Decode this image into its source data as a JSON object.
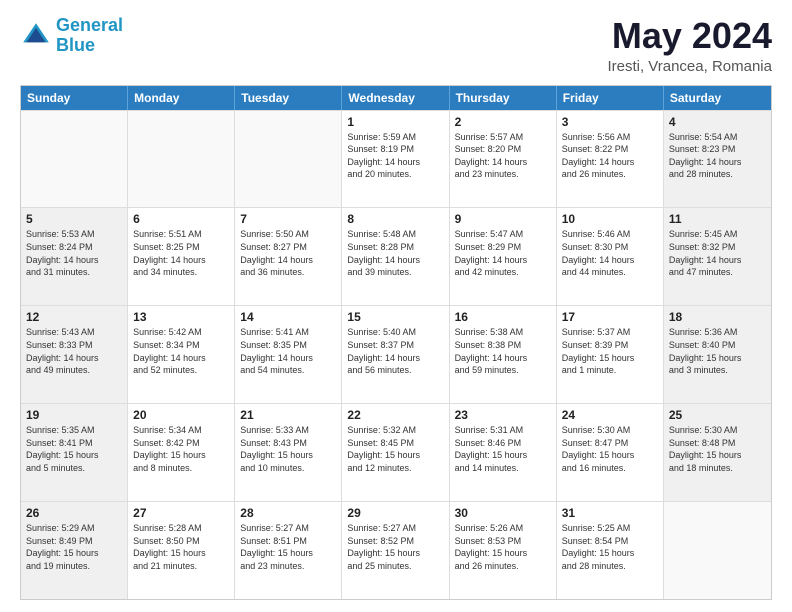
{
  "logo": {
    "text1": "General",
    "text2": "Blue"
  },
  "title": "May 2024",
  "location": "Iresti, Vrancea, Romania",
  "days": [
    "Sunday",
    "Monday",
    "Tuesday",
    "Wednesday",
    "Thursday",
    "Friday",
    "Saturday"
  ],
  "rows": [
    [
      {
        "day": "",
        "info": ""
      },
      {
        "day": "",
        "info": ""
      },
      {
        "day": "",
        "info": ""
      },
      {
        "day": "1",
        "info": "Sunrise: 5:59 AM\nSunset: 8:19 PM\nDaylight: 14 hours\nand 20 minutes."
      },
      {
        "day": "2",
        "info": "Sunrise: 5:57 AM\nSunset: 8:20 PM\nDaylight: 14 hours\nand 23 minutes."
      },
      {
        "day": "3",
        "info": "Sunrise: 5:56 AM\nSunset: 8:22 PM\nDaylight: 14 hours\nand 26 minutes."
      },
      {
        "day": "4",
        "info": "Sunrise: 5:54 AM\nSunset: 8:23 PM\nDaylight: 14 hours\nand 28 minutes."
      }
    ],
    [
      {
        "day": "5",
        "info": "Sunrise: 5:53 AM\nSunset: 8:24 PM\nDaylight: 14 hours\nand 31 minutes."
      },
      {
        "day": "6",
        "info": "Sunrise: 5:51 AM\nSunset: 8:25 PM\nDaylight: 14 hours\nand 34 minutes."
      },
      {
        "day": "7",
        "info": "Sunrise: 5:50 AM\nSunset: 8:27 PM\nDaylight: 14 hours\nand 36 minutes."
      },
      {
        "day": "8",
        "info": "Sunrise: 5:48 AM\nSunset: 8:28 PM\nDaylight: 14 hours\nand 39 minutes."
      },
      {
        "day": "9",
        "info": "Sunrise: 5:47 AM\nSunset: 8:29 PM\nDaylight: 14 hours\nand 42 minutes."
      },
      {
        "day": "10",
        "info": "Sunrise: 5:46 AM\nSunset: 8:30 PM\nDaylight: 14 hours\nand 44 minutes."
      },
      {
        "day": "11",
        "info": "Sunrise: 5:45 AM\nSunset: 8:32 PM\nDaylight: 14 hours\nand 47 minutes."
      }
    ],
    [
      {
        "day": "12",
        "info": "Sunrise: 5:43 AM\nSunset: 8:33 PM\nDaylight: 14 hours\nand 49 minutes."
      },
      {
        "day": "13",
        "info": "Sunrise: 5:42 AM\nSunset: 8:34 PM\nDaylight: 14 hours\nand 52 minutes."
      },
      {
        "day": "14",
        "info": "Sunrise: 5:41 AM\nSunset: 8:35 PM\nDaylight: 14 hours\nand 54 minutes."
      },
      {
        "day": "15",
        "info": "Sunrise: 5:40 AM\nSunset: 8:37 PM\nDaylight: 14 hours\nand 56 minutes."
      },
      {
        "day": "16",
        "info": "Sunrise: 5:38 AM\nSunset: 8:38 PM\nDaylight: 14 hours\nand 59 minutes."
      },
      {
        "day": "17",
        "info": "Sunrise: 5:37 AM\nSunset: 8:39 PM\nDaylight: 15 hours\nand 1 minute."
      },
      {
        "day": "18",
        "info": "Sunrise: 5:36 AM\nSunset: 8:40 PM\nDaylight: 15 hours\nand 3 minutes."
      }
    ],
    [
      {
        "day": "19",
        "info": "Sunrise: 5:35 AM\nSunset: 8:41 PM\nDaylight: 15 hours\nand 5 minutes."
      },
      {
        "day": "20",
        "info": "Sunrise: 5:34 AM\nSunset: 8:42 PM\nDaylight: 15 hours\nand 8 minutes."
      },
      {
        "day": "21",
        "info": "Sunrise: 5:33 AM\nSunset: 8:43 PM\nDaylight: 15 hours\nand 10 minutes."
      },
      {
        "day": "22",
        "info": "Sunrise: 5:32 AM\nSunset: 8:45 PM\nDaylight: 15 hours\nand 12 minutes."
      },
      {
        "day": "23",
        "info": "Sunrise: 5:31 AM\nSunset: 8:46 PM\nDaylight: 15 hours\nand 14 minutes."
      },
      {
        "day": "24",
        "info": "Sunrise: 5:30 AM\nSunset: 8:47 PM\nDaylight: 15 hours\nand 16 minutes."
      },
      {
        "day": "25",
        "info": "Sunrise: 5:30 AM\nSunset: 8:48 PM\nDaylight: 15 hours\nand 18 minutes."
      }
    ],
    [
      {
        "day": "26",
        "info": "Sunrise: 5:29 AM\nSunset: 8:49 PM\nDaylight: 15 hours\nand 19 minutes."
      },
      {
        "day": "27",
        "info": "Sunrise: 5:28 AM\nSunset: 8:50 PM\nDaylight: 15 hours\nand 21 minutes."
      },
      {
        "day": "28",
        "info": "Sunrise: 5:27 AM\nSunset: 8:51 PM\nDaylight: 15 hours\nand 23 minutes."
      },
      {
        "day": "29",
        "info": "Sunrise: 5:27 AM\nSunset: 8:52 PM\nDaylight: 15 hours\nand 25 minutes."
      },
      {
        "day": "30",
        "info": "Sunrise: 5:26 AM\nSunset: 8:53 PM\nDaylight: 15 hours\nand 26 minutes."
      },
      {
        "day": "31",
        "info": "Sunrise: 5:25 AM\nSunset: 8:54 PM\nDaylight: 15 hours\nand 28 minutes."
      },
      {
        "day": "",
        "info": ""
      }
    ]
  ]
}
